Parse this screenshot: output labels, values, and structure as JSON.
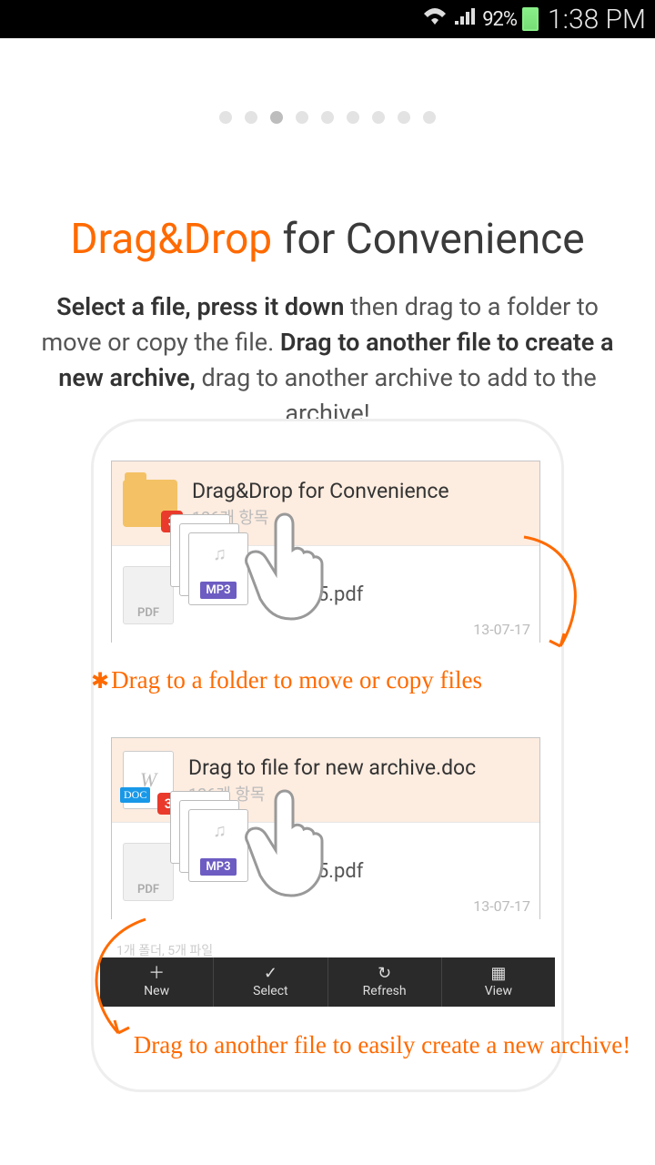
{
  "status_bar": {
    "battery_pct": "92%",
    "time": "1:38 PM"
  },
  "pager": {
    "count": 9,
    "active_index": 2
  },
  "title": {
    "accent": "Drag&Drop",
    "rest": " for Convenience"
  },
  "description": {
    "seg1_bold": "Select a file, press it down",
    "seg1_rest": " then drag to a folder to move or copy the file. ",
    "seg2_bold": "Drag to another file to create a new archive,",
    "seg2_rest": " drag to another archive to add to the archive!"
  },
  "card1": {
    "row1_title": "Drag&Drop for Convenience",
    "row1_sub": "126개 항목",
    "badge": "3",
    "row2_filename": "130615.pdf",
    "row2_date": "13-07-17",
    "mp3_label": "MP3",
    "pdf_label": "PDF"
  },
  "card2": {
    "row1_title": "Drag to file for new archive.doc",
    "row1_sub": "126개 항목",
    "badge": "3",
    "doc_letter": "W",
    "doc_label": "DOC",
    "row2_filename": "130615.pdf",
    "row2_date": "13-07-17",
    "mp3_label": "MP3",
    "pdf_label": "PDF"
  },
  "annotations": {
    "line1": "Drag to a folder to move or copy files",
    "line2": "Drag to another file to easily create a new archive!"
  },
  "toolbar": {
    "sub": "1개 폴더, 5개 파일",
    "items": [
      "New",
      "Select",
      "Refresh",
      "View"
    ]
  }
}
